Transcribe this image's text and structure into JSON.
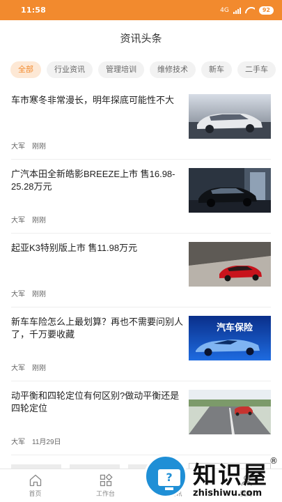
{
  "status_bar": {
    "time": "11:58",
    "network": "4G",
    "battery": "92"
  },
  "header": {
    "title": "资讯头条"
  },
  "tabs": [
    {
      "label": "全部",
      "active": true
    },
    {
      "label": "行业资讯",
      "active": false
    },
    {
      "label": "管理培训",
      "active": false
    },
    {
      "label": "维修技术",
      "active": false
    },
    {
      "label": "新车",
      "active": false
    },
    {
      "label": "二手车",
      "active": false
    }
  ],
  "articles": [
    {
      "title": "车市寒冬非常漫长，明年探底可能性不大",
      "author": "大军",
      "time": "刚刚",
      "image": "silver-sedan"
    },
    {
      "title": "广汽本田全新皓影BREEZE上市 售16.98-25.28万元",
      "author": "大军",
      "time": "刚刚",
      "image": "dark-suv"
    },
    {
      "title": " 起亚K3特别版上市 售11.98万元",
      "author": "大军",
      "time": "刚刚",
      "image": "red-sedan"
    },
    {
      "title": "新车车险怎么上最划算？再也不需要问别人了，千万要收藏",
      "author": "大军",
      "time": "刚刚",
      "image": "car-insurance",
      "image_caption": "汽车保险"
    },
    {
      "title": "动平衡和四轮定位有何区别?做动平衡还是四轮定位",
      "author": "大军",
      "time": "11月29日",
      "image": "road-car"
    }
  ],
  "bottom_nav": [
    {
      "label": "首页",
      "icon": "home-icon"
    },
    {
      "label": "工作台",
      "icon": "grid-icon"
    },
    {
      "label": "资讯",
      "icon": "news-icon"
    },
    {
      "label": "我的",
      "icon": "user-icon"
    }
  ],
  "watermark": {
    "text": "知识屋",
    "url": "zhishiwu.com",
    "mark": "®"
  },
  "colors": {
    "accent": "#f28a2e",
    "tab_active_bg": "#fde8d5",
    "tab_bg": "#f2f2f2"
  }
}
